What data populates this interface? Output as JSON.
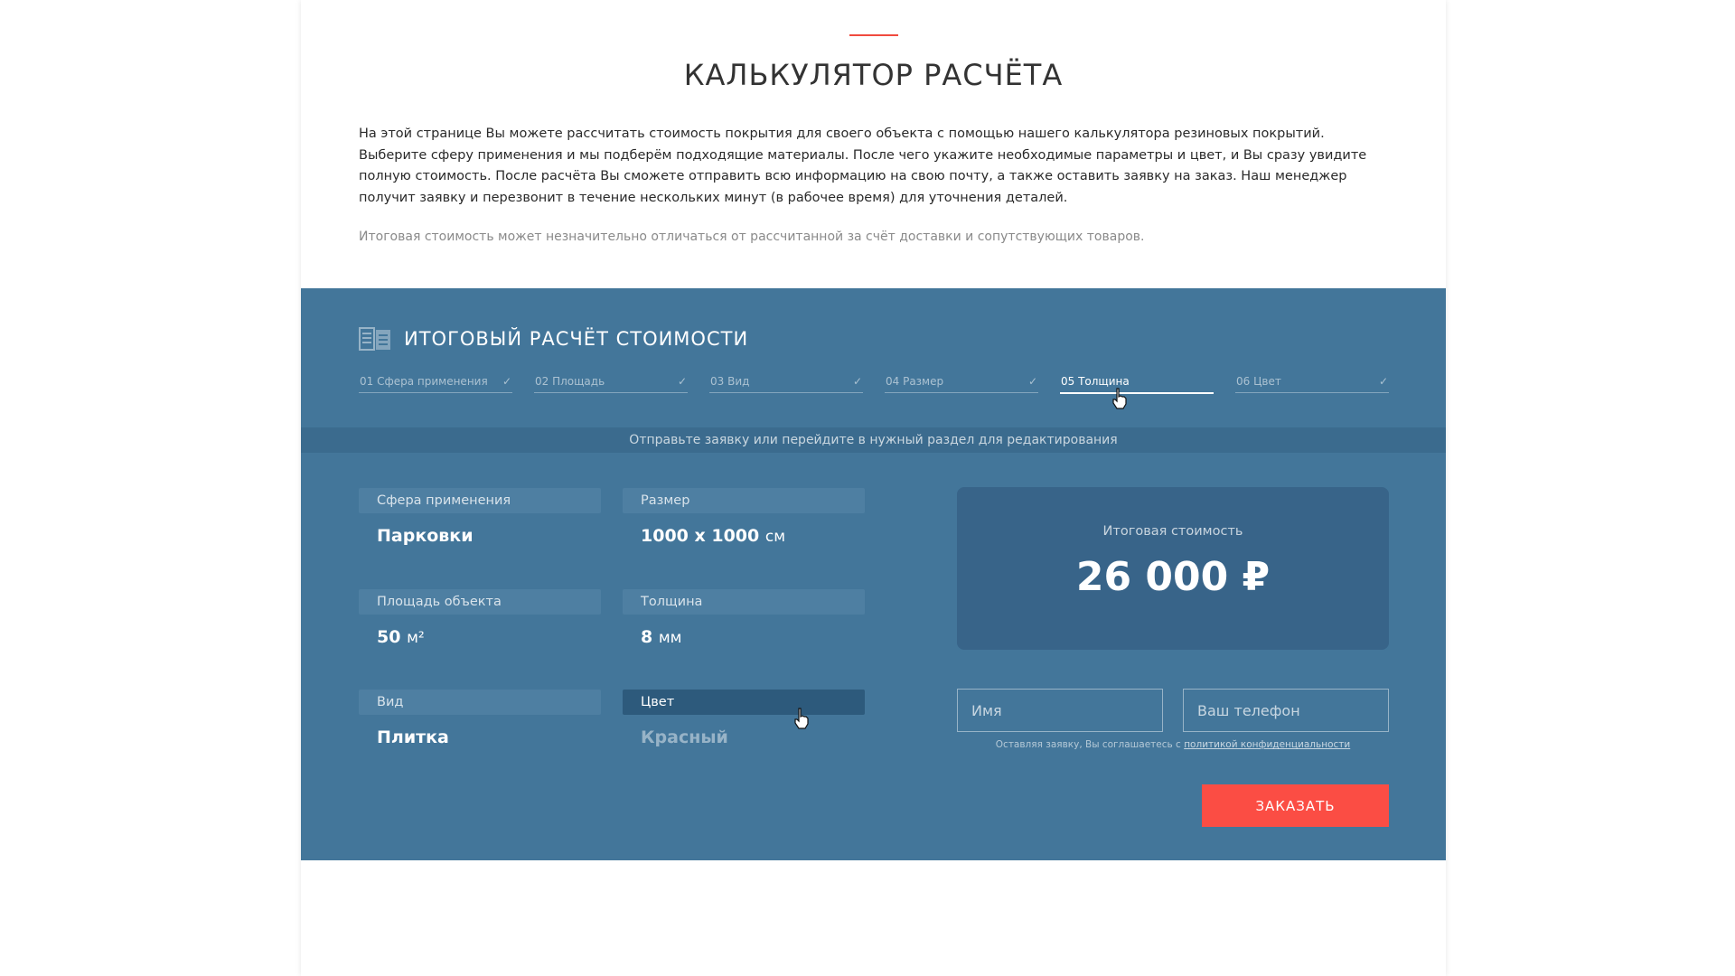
{
  "page": {
    "title": "КАЛЬКУЛЯТОР РАСЧЁТА",
    "intro": "На этой странице Вы можете рассчитать стоимость покрытия для своего объекта с помощью нашего калькулятора резиновых покрытий. Выберите сферу применения и мы подберём подходящие материалы. После чего укажите необходимые параметры и цвет, и Вы сразу увидите полную стоимость. После расчёта Вы сможете отправить всю информацию на свою почту, а также оставить заявку на заказ. Наш менеджер получит заявку и перезвонит в течение нескольких минут (в рабочее время) для уточнения деталей.",
    "note": "Итоговая стоимость может незначительно отличаться от рассчитанной за счёт доставки и сопутствующих товаров."
  },
  "calculator": {
    "title": "ИТОГОВЫЙ РАСЧЁТ СТОИМОСТИ",
    "icon": "calculator-icon",
    "steps": [
      {
        "label": "01 Сфера применения",
        "check": "✓"
      },
      {
        "label": "02 Площадь",
        "check": "✓"
      },
      {
        "label": "03 Вид",
        "check": "✓"
      },
      {
        "label": "04 Размер",
        "check": "✓"
      },
      {
        "label": "05 Толщина",
        "check": ""
      },
      {
        "label": "06 Цвет",
        "check": "✓"
      }
    ],
    "active_step": "05 Толщина",
    "hint": "Отправьте заявку или перейдите в нужный раздел для редактирования",
    "fields": {
      "sphere": {
        "label": "Сфера применения",
        "value": "Парковки"
      },
      "area": {
        "label": "Площадь объекта",
        "value": "50",
        "unit": "м²"
      },
      "type": {
        "label": "Вид",
        "value": "Плитка"
      },
      "size": {
        "label": "Размер",
        "value": "1000 x 1000",
        "unit": "см"
      },
      "thickness": {
        "label": "Толщина",
        "value": "8",
        "unit": "мм"
      },
      "color": {
        "label": "Цвет",
        "value": "Красный"
      }
    },
    "total": {
      "label": "Итоговая стоимость",
      "value": "26 000 ₽"
    },
    "form": {
      "name_placeholder": "Имя",
      "phone_placeholder": "Ваш телефон",
      "consent_text": "Оставляя заявку, Вы соглашаетесь с",
      "consent_link": "политикой конфиденциальности",
      "order_label": "ЗАКАЗАТЬ"
    }
  },
  "colors": {
    "accent": "#f04a3e",
    "panel": "#43769a",
    "button": "#fb4d44"
  }
}
